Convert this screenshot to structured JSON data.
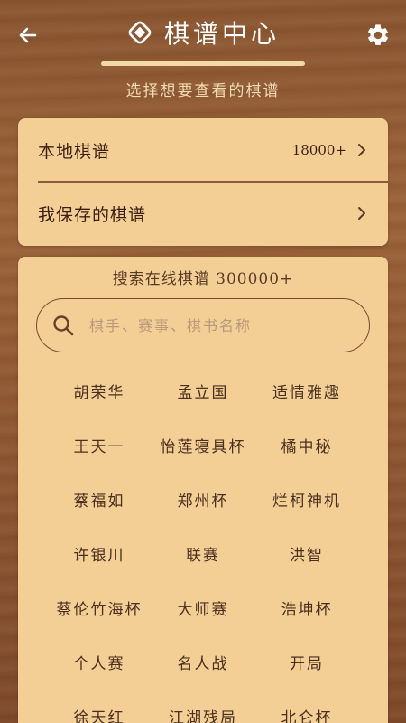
{
  "header": {
    "title": "棋谱中心",
    "subtitle": "选择想要查看的棋谱",
    "icons": {
      "back": "back-arrow-icon",
      "logo": "diamond-logo-icon",
      "settings": "gear-icon"
    }
  },
  "colors": {
    "card_bg": "#f3cf95",
    "accent_line": "#f2d9a6",
    "text_dark": "#3c1f10"
  },
  "local_section": {
    "items": [
      {
        "label": "本地棋谱",
        "count": "18000+"
      },
      {
        "label": "我保存的棋谱"
      }
    ]
  },
  "online_section": {
    "title": "搜索在线棋谱 300000+",
    "search_placeholder": "棋手、赛事、棋书名称",
    "tags": [
      [
        "胡荣华",
        "孟立国",
        "适情雅趣"
      ],
      [
        "王天一",
        "怡莲寝具杯",
        "橘中秘"
      ],
      [
        "蔡福如",
        "郑州杯",
        "烂柯神机"
      ],
      [
        "许银川",
        "联赛",
        "洪智"
      ],
      [
        "蔡伦竹海杯",
        "大师赛",
        "浩坤杯"
      ],
      [
        "个人赛",
        "名人战",
        "开局"
      ],
      [
        "徐天红",
        "江湖残局",
        "北仑杯"
      ]
    ]
  }
}
